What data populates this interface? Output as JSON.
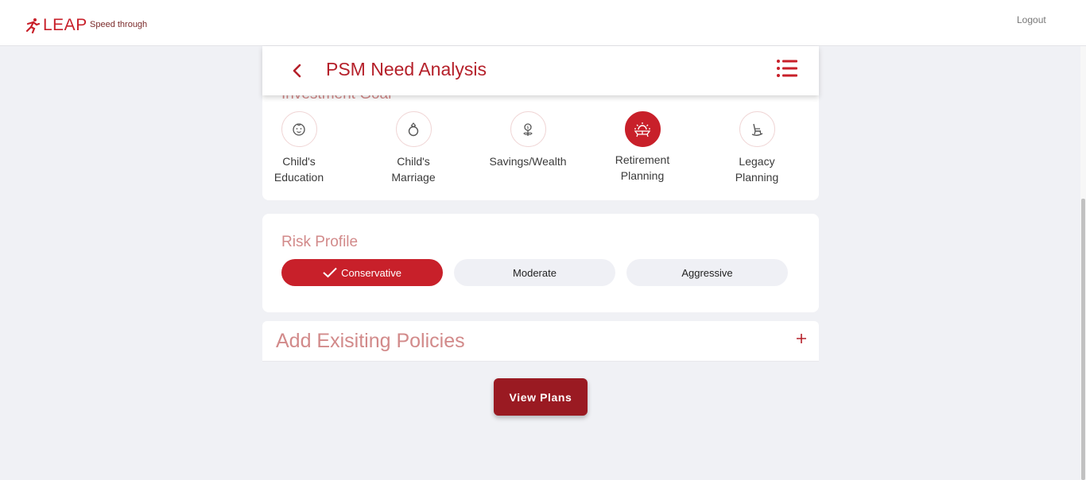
{
  "brand": {
    "name": "LEAP",
    "tagline": "Speed through"
  },
  "topbar": {
    "logout_label": "Logout"
  },
  "header": {
    "title": "PSM Need Analysis"
  },
  "investment_goal": {
    "section_title": "Investment Goal",
    "items": [
      {
        "line1": "Child's",
        "line2": "Education",
        "icon": "baby-face-icon",
        "selected": false
      },
      {
        "line1": "Child's",
        "line2": "Marriage",
        "icon": "ring-icon",
        "selected": false
      },
      {
        "line1": "Savings/Wealth",
        "line2": "",
        "icon": "money-plant-icon",
        "selected": false
      },
      {
        "line1": "Retirement",
        "line2": "Planning",
        "icon": "sunset-bench-icon",
        "selected": true
      },
      {
        "line1": "Legacy",
        "line2": "Planning",
        "icon": "rocking-chair-icon",
        "selected": false
      }
    ]
  },
  "risk_profile": {
    "title": "Risk Profile",
    "options": [
      {
        "label": "Conservative",
        "selected": true
      },
      {
        "label": "Moderate",
        "selected": false
      },
      {
        "label": "Aggressive",
        "selected": false
      }
    ]
  },
  "policies": {
    "title": "Add Exisiting Policies"
  },
  "actions": {
    "view_plans_label": "View Plans"
  },
  "colors": {
    "brand_red": "#c8202a",
    "dark_red": "#9a1a22",
    "muted_red": "#d28a8a",
    "background": "#f0f1f5"
  }
}
